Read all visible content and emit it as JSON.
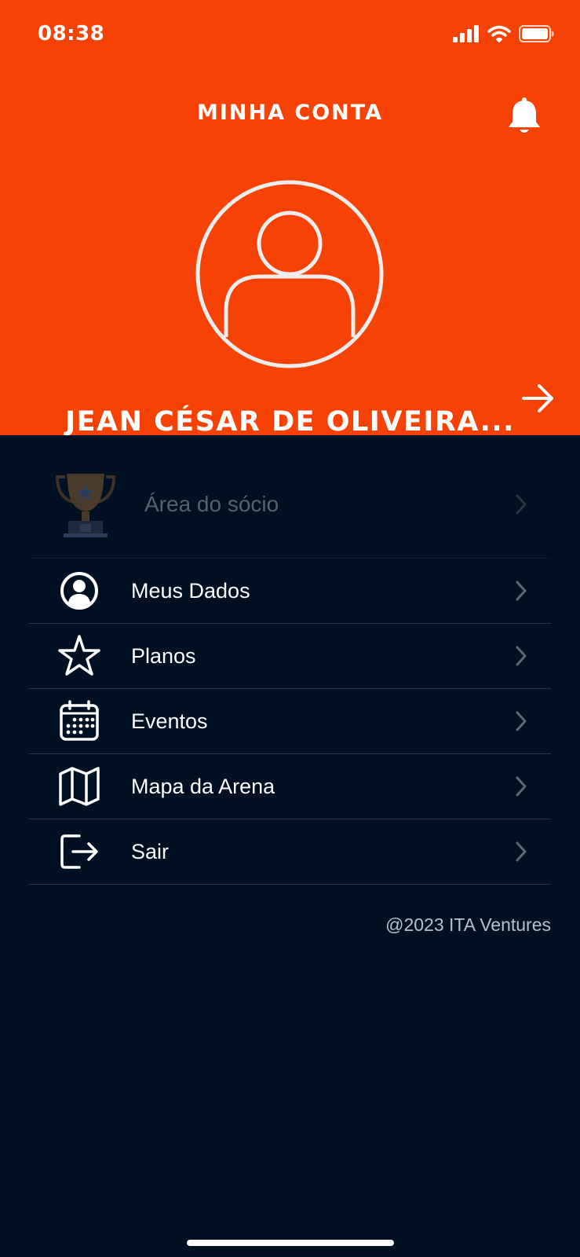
{
  "status_bar": {
    "time": "08:38"
  },
  "header": {
    "title": "MINHA CONTA",
    "user_name": "JEAN CÉSAR DE OLIVEIRA..."
  },
  "menu": {
    "items": [
      {
        "label": "Área do sócio",
        "icon": "trophy-icon",
        "enabled": false
      },
      {
        "label": "Meus Dados",
        "icon": "user-circle-icon",
        "enabled": true
      },
      {
        "label": "Planos",
        "icon": "star-icon",
        "enabled": true
      },
      {
        "label": "Eventos",
        "icon": "calendar-icon",
        "enabled": true
      },
      {
        "label": "Mapa da Arena",
        "icon": "map-icon",
        "enabled": true
      },
      {
        "label": "Sair",
        "icon": "logout-icon",
        "enabled": true
      }
    ]
  },
  "footer": {
    "copyright": "@2023 ITA Ventures"
  },
  "colors": {
    "header_bg": "#F64305",
    "page_bg": "#000F22",
    "divider": "#2A3446",
    "disabled_text": "#556071"
  }
}
